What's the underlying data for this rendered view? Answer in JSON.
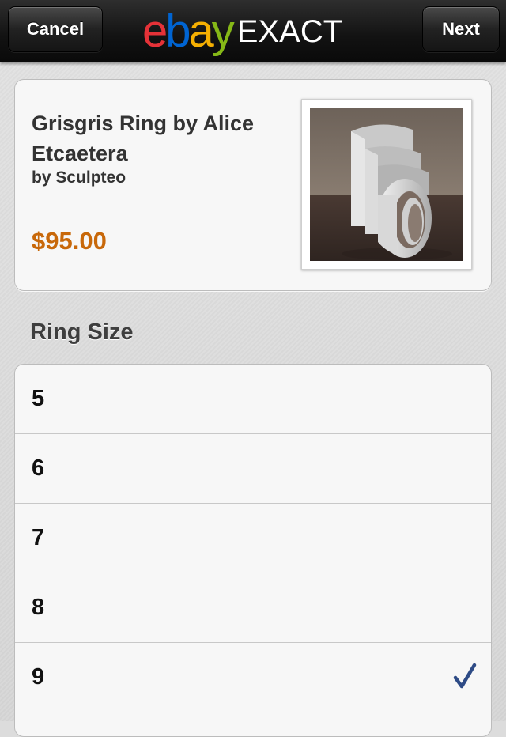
{
  "navbar": {
    "cancel_label": "Cancel",
    "next_label": "Next",
    "logo": {
      "letters": [
        "e",
        "b",
        "a",
        "y"
      ],
      "letter_colors": [
        "#e53238",
        "#0064d2",
        "#f5af02",
        "#86b817"
      ],
      "suffix": "EXACT"
    }
  },
  "product": {
    "title": "Grisgris Ring by Alice Etcaetera",
    "seller": "by Sculpteo",
    "price": "$95.00",
    "price_color": "#c8680a",
    "image_icon": "ring-photo"
  },
  "section": {
    "title": "Ring Size"
  },
  "sizes": [
    {
      "label": "5",
      "selected": false
    },
    {
      "label": "6",
      "selected": false
    },
    {
      "label": "7",
      "selected": false
    },
    {
      "label": "8",
      "selected": false
    },
    {
      "label": "9",
      "selected": true
    }
  ],
  "checkmark_icon": "checkmark-icon",
  "checkmark_color": "#2e4b86"
}
